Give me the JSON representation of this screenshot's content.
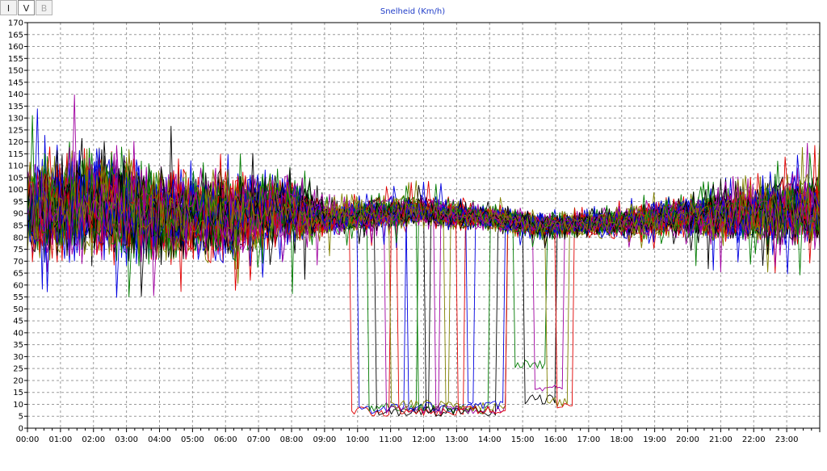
{
  "toolbar": {
    "buttons": [
      "I",
      "V",
      "B"
    ],
    "active": "V",
    "disabled": "B"
  },
  "chart_data": {
    "type": "line",
    "title": "Snelheid (Km/h)",
    "xlabel": "",
    "ylabel": "",
    "ylim": [
      0,
      170
    ],
    "y_ticks": [
      0,
      5,
      10,
      15,
      20,
      25,
      30,
      35,
      40,
      45,
      50,
      55,
      60,
      65,
      70,
      75,
      80,
      85,
      90,
      95,
      100,
      105,
      110,
      115,
      120,
      125,
      130,
      135,
      140,
      145,
      150,
      155,
      160,
      165,
      170
    ],
    "x_ticks": [
      "00:00",
      "01:00",
      "02:00",
      "03:00",
      "04:00",
      "05:00",
      "06:00",
      "07:00",
      "08:00",
      "09:00",
      "10:00",
      "11:00",
      "12:00",
      "13:00",
      "14:00",
      "15:00",
      "16:00",
      "17:00",
      "18:00",
      "19:00",
      "20:00",
      "21:00",
      "22:00",
      "23:00"
    ],
    "xlim_hours": [
      0,
      24
    ],
    "grid": true,
    "colors": [
      "#e00000",
      "#0000e0",
      "#007a00",
      "#000000",
      "#a000a0",
      "#808000"
    ],
    "typical_profile": {
      "hours": [
        0,
        2,
        4,
        6,
        8,
        9,
        12,
        14,
        15.5,
        18,
        20,
        22,
        24
      ],
      "speed": [
        92,
        95,
        90,
        88,
        92,
        88,
        91,
        88,
        85,
        86,
        89,
        90,
        91
      ],
      "spread": [
        22,
        26,
        22,
        20,
        18,
        8,
        7,
        6,
        6,
        7,
        10,
        14,
        16
      ]
    },
    "congestion_dips": {
      "near_start_hour": [
        9.8,
        10.0,
        10.3,
        10.5,
        10.8,
        11.0,
        11.2,
        11.5,
        11.8,
        12.0,
        12.3,
        12.6,
        13.0,
        13.3,
        14.7,
        15.0,
        15.3,
        15.7,
        16.0
      ],
      "near_end_hour": [
        11.0,
        11.4,
        11.8,
        12.2,
        12.5,
        12.8,
        13.2,
        13.5,
        14.0,
        14.2,
        14.5,
        14.5,
        14.5,
        14.4,
        15.7,
        16.0,
        16.2,
        16.4,
        16.5
      ],
      "low_speed": [
        5,
        6,
        7,
        5,
        6,
        8,
        5,
        7,
        6,
        5,
        6,
        7,
        6,
        8,
        25,
        10,
        15,
        9,
        7
      ]
    },
    "series_count": 60
  }
}
